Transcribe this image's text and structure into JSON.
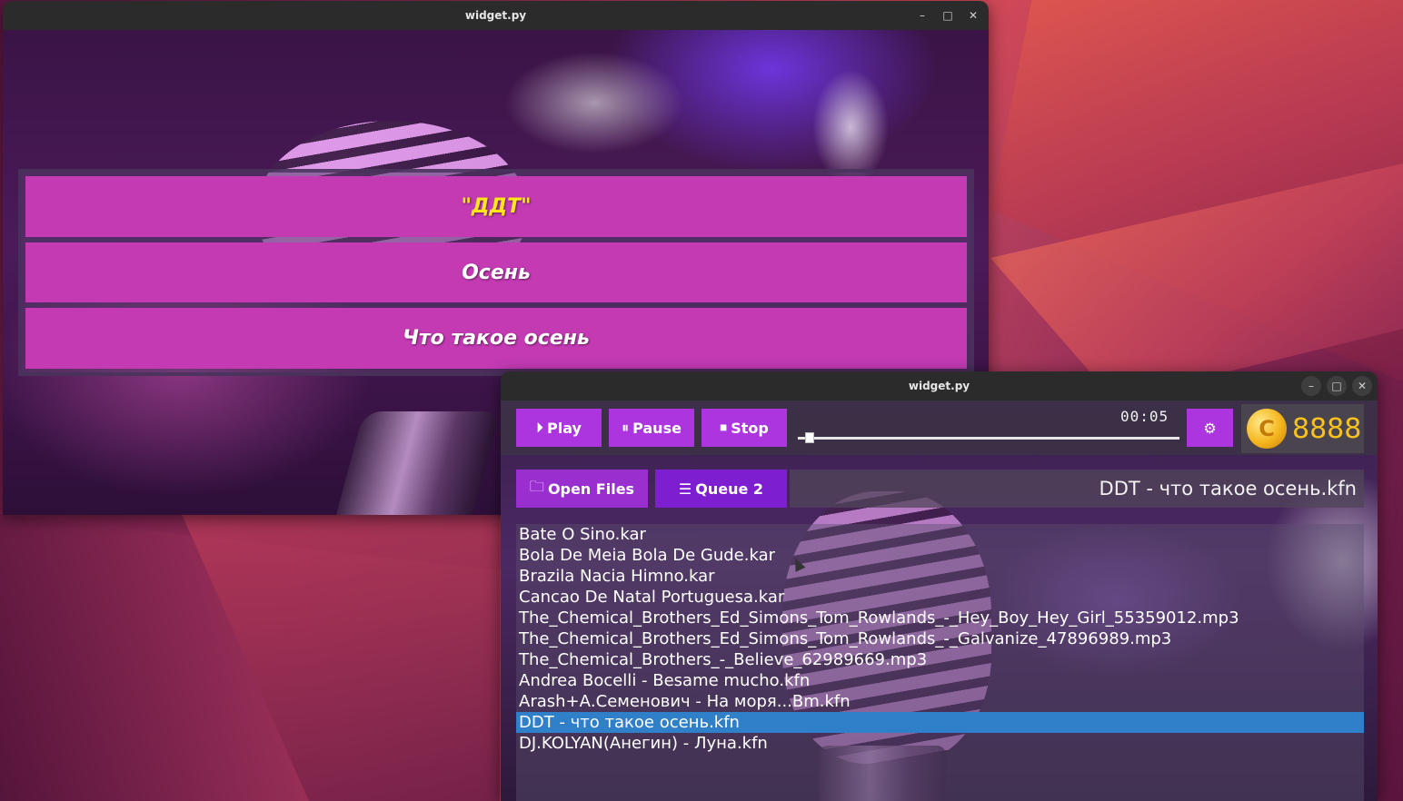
{
  "lyrics_window": {
    "title": "widget.py",
    "controls": {
      "minimize": "–",
      "maximize": "□",
      "close": "✕"
    },
    "lines": [
      {
        "text": "\"ДДТ\"",
        "active": true
      },
      {
        "text": "Осень",
        "active": false
      },
      {
        "text": "Что такое осень",
        "active": false
      }
    ],
    "colors": {
      "line_bg": "#c33ab3",
      "active_text": "#ffe71a",
      "text": "#ffffff"
    }
  },
  "player_window": {
    "title": "widget.py",
    "controls": {
      "minimize": "–",
      "maximize": "□",
      "close": "✕"
    },
    "transport": {
      "play_label": "Play",
      "pause_label": "Pause",
      "stop_label": "Stop",
      "play_icon": "play-circle-icon",
      "pause_icon": "pause-circle-icon",
      "stop_icon": "stop-circle-icon"
    },
    "timer": "00:05",
    "progress_fraction": 0.02,
    "settings_icon": "gear-icon",
    "coins": {
      "icon": "coin-icon",
      "count": "8888"
    },
    "file_bar": {
      "open_label": "Open Files",
      "open_icon": "folder-icon",
      "queue_label": "Queue 2",
      "queue_icon": "queue-music-icon",
      "now_playing": "DDT - что такое осень.kfn"
    },
    "playlist": [
      "Bate O Sino.kar",
      "Bola De Meia Bola De Gude.kar",
      "Brazila Nacia Himno.kar",
      "Cancao De Natal Portuguesa.kar",
      "The_Chemical_Brothers_Ed_Simons_Tom_Rowlands_-_Hey_Boy_Hey_Girl_55359012.mp3",
      "The_Chemical_Brothers_Ed_Simons_Tom_Rowlands_-_Galvanize_47896989.mp3",
      "The_Chemical_Brothers_-_Believe_62989669.mp3",
      "Andrea Bocelli - Besame mucho.kfn",
      "Arash+А.Семенович - На моря...Bm.kfn",
      "DDT - что такое осень.kfn",
      "DJ.KOLYAN(Анегин) - Луна.kfn"
    ],
    "selected_index": 9,
    "colors": {
      "button": "#ad35e0",
      "queue_button": "#7d1fd0",
      "selection": "#2f7fc9",
      "coin_text": "#f8c21c"
    }
  }
}
